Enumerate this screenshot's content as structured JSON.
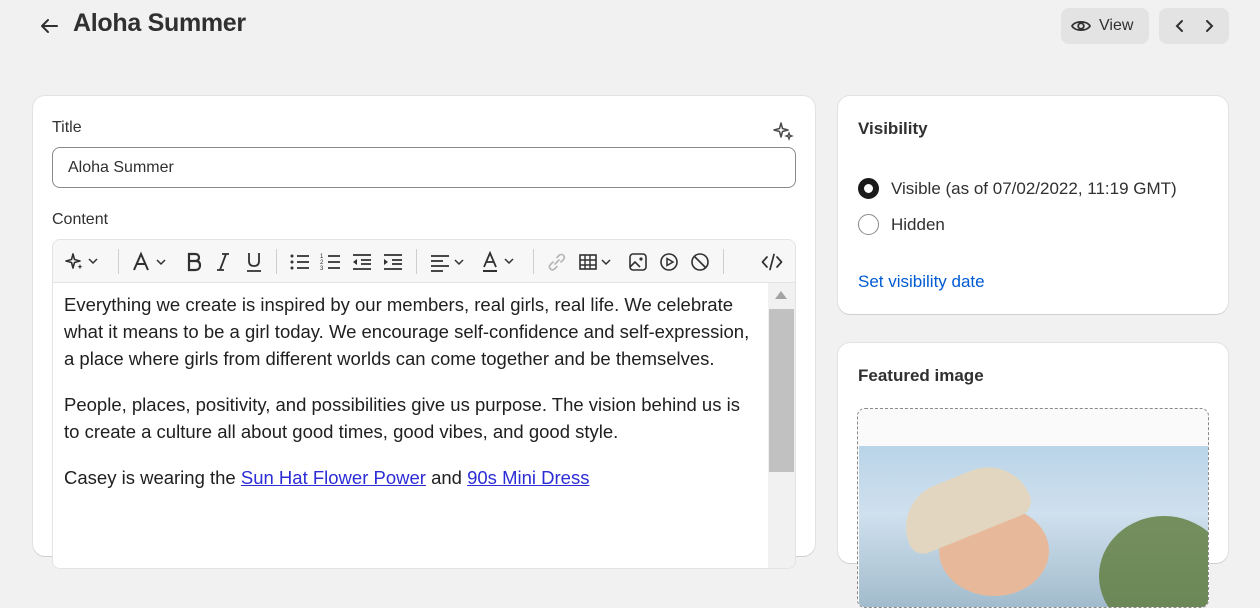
{
  "header": {
    "title": "Aloha Summer",
    "view_label": "View"
  },
  "main": {
    "title_label": "Title",
    "title_value": "Aloha Summer",
    "content_label": "Content",
    "paragraphs": [
      "Everything we create is inspired by our members, real girls, real life. We celebrate what it means to be a girl today. We encourage self-confidence and self-expression, a place where girls from different worlds can come together and be themselves.",
      "People, places, positivity, and possibilities give us purpose. The vision behind us is to create a culture all about good times, good vibes, and good style."
    ],
    "para3": {
      "prefix": "Casey is wearing the ",
      "link1": "Sun Hat Flower Power",
      "middle": " and ",
      "link2": "90s Mini Dress"
    },
    "toolbar_icons": [
      "magic-icon",
      "text-style-icon",
      "bold-icon",
      "italic-icon",
      "underline-icon",
      "bullet-list-icon",
      "numbered-list-icon",
      "outdent-icon",
      "indent-icon",
      "align-icon",
      "text-color-icon",
      "link-icon",
      "table-icon",
      "image-icon",
      "video-icon",
      "block-icon",
      "code-icon"
    ]
  },
  "visibility": {
    "heading": "Visibility",
    "options": [
      {
        "label": "Visible (as of 07/02/2022, 11:19 GMT)",
        "checked": true
      },
      {
        "label": "Hidden",
        "checked": false
      }
    ],
    "set_date_link": "Set visibility date"
  },
  "featured_image": {
    "heading": "Featured image"
  },
  "colors": {
    "background": "#f1f1f1",
    "link": "#005bd3",
    "content_link": "#2c2cd6",
    "text": "#303030"
  }
}
